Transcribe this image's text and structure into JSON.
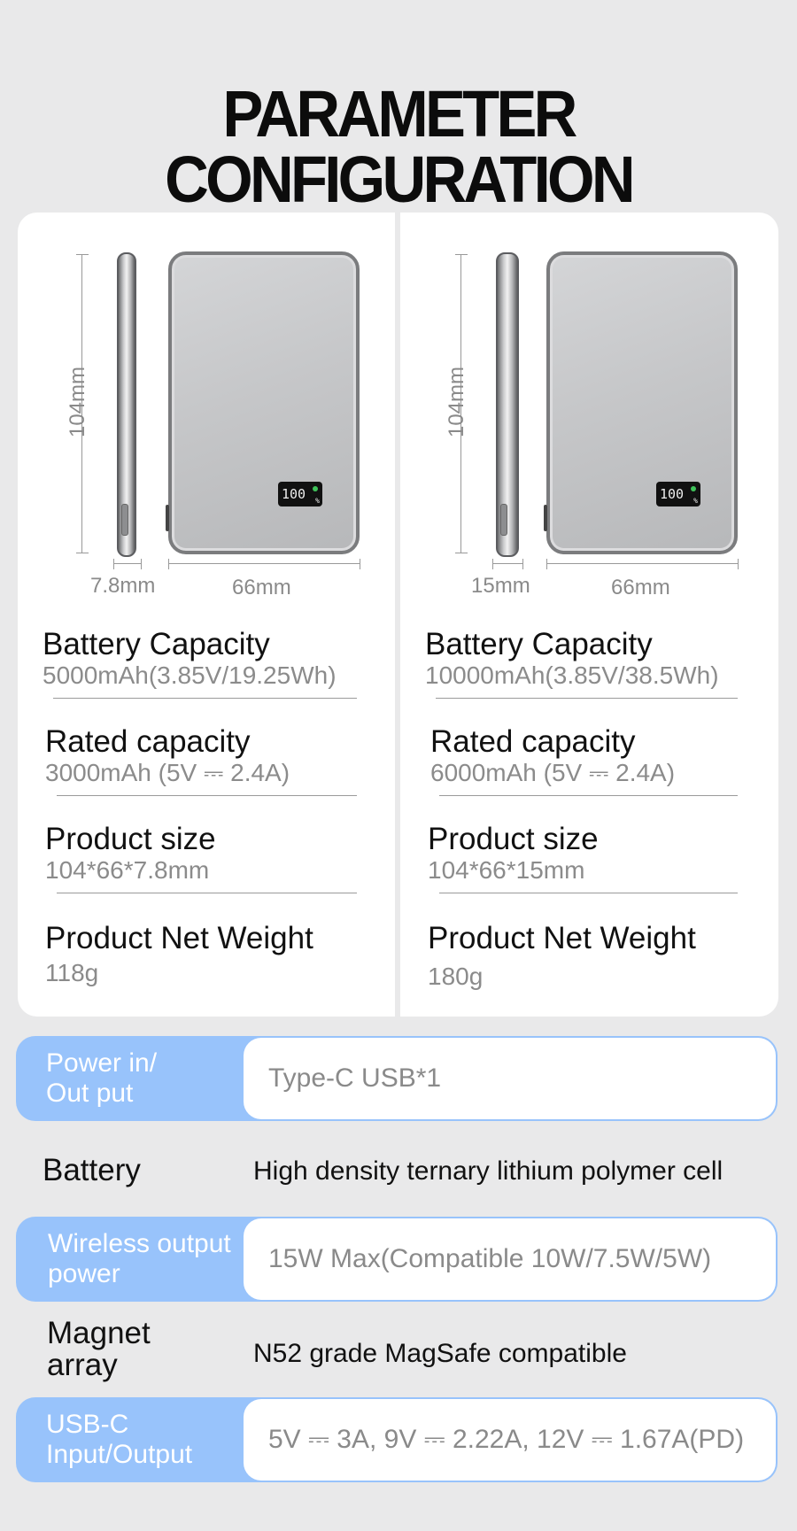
{
  "title": "PARAMETER CONFIGURATION",
  "products": [
    {
      "height_label": "104mm",
      "thickness_label": "7.8mm",
      "width_label": "66mm",
      "lcd_text": "100",
      "specs": [
        {
          "label": "Battery Capacity",
          "value": "5000mAh(3.85V/19.25Wh)"
        },
        {
          "label": "Rated capacity",
          "value": "3000mAh (5V ⎓ 2.4A)"
        },
        {
          "label": "Product size",
          "value": "104*66*7.8mm"
        },
        {
          "label": "Product Net Weight",
          "value": "118g"
        }
      ]
    },
    {
      "height_label": "104mm",
      "thickness_label": "15mm",
      "width_label": "66mm",
      "lcd_text": "100",
      "specs": [
        {
          "label": "Battery Capacity",
          "value": "10000mAh(3.85V/38.5Wh)"
        },
        {
          "label": "Rated capacity",
          "value": "6000mAh (5V ⎓ 2.4A)"
        },
        {
          "label": "Product size",
          "value": "104*66*15mm"
        },
        {
          "label": "Product Net Weight",
          "value": "180g"
        }
      ]
    }
  ],
  "table": [
    {
      "label": "Power in/\nOut put",
      "value": "Type-C USB*1",
      "highlight": true
    },
    {
      "label": "Battery",
      "value": "High density ternary lithium polymer cell",
      "highlight": false
    },
    {
      "label": "Wireless output power",
      "value": "15W Max(Compatible 10W/7.5W/5W)",
      "highlight": true
    },
    {
      "label": "Magnet array",
      "value": "N52 grade MagSafe compatible",
      "highlight": false
    },
    {
      "label": "USB-C Input/Output",
      "value": "5V ⎓ 3A, 9V ⎓ 2.22A, 12V ⎓ 1.67A(PD)",
      "highlight": true
    }
  ],
  "colors": {
    "background": "#e9e9ea",
    "band_blue": "#98c3fb",
    "card": "#ffffff"
  }
}
